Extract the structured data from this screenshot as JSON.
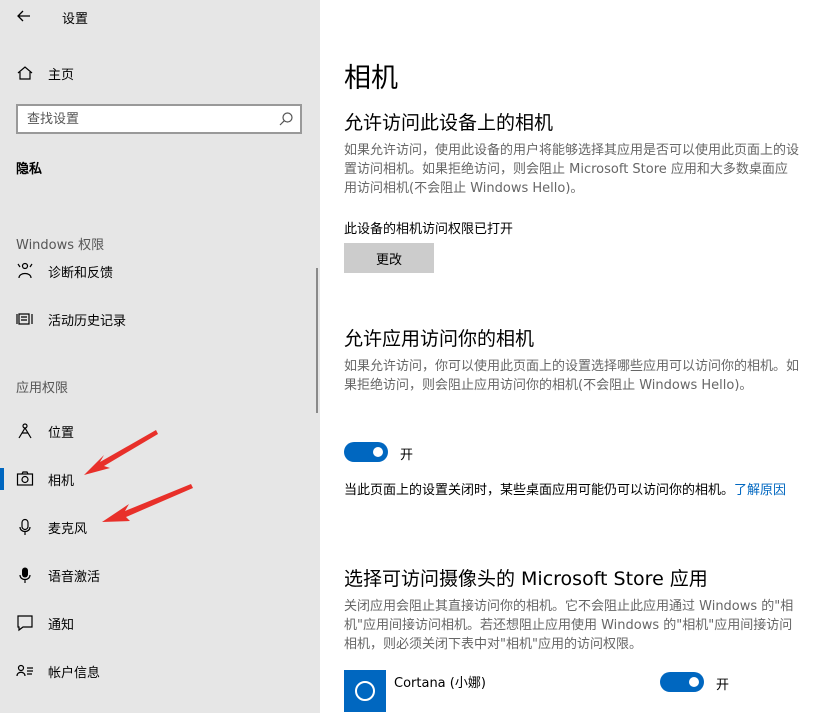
{
  "window": {
    "title": "设置"
  },
  "sidebar": {
    "home_label": "主页",
    "search_placeholder": "查找设置",
    "section_title": "隐私",
    "windows_group_label": "Windows 权限",
    "windows_items": [
      {
        "label": "诊断和反馈",
        "icon": "diagnostics-icon"
      },
      {
        "label": "活动历史记录",
        "icon": "activity-history-icon"
      }
    ],
    "app_group_label": "应用权限",
    "app_items": [
      {
        "label": "位置",
        "icon": "location-icon"
      },
      {
        "label": "相机",
        "icon": "camera-icon",
        "selected": true
      },
      {
        "label": "麦克风",
        "icon": "microphone-icon"
      },
      {
        "label": "语音激活",
        "icon": "voice-activation-icon"
      },
      {
        "label": "通知",
        "icon": "notification-icon"
      },
      {
        "label": "帐户信息",
        "icon": "account-info-icon"
      }
    ]
  },
  "main": {
    "page_title": "相机",
    "device_section": {
      "heading": "允许访问此设备上的相机",
      "description": "如果允许访问，使用此设备的用户将能够选择其应用是否可以使用此页面上的设置访问相机。如果拒绝访问，则会阻止 Microsoft Store 应用和大多数桌面应用访问相机(不会阻止 Windows Hello)。",
      "status": "此设备的相机访问权限已打开",
      "change_button": "更改"
    },
    "apps_section": {
      "heading": "允许应用访问你的相机",
      "description": "如果允许访问，你可以使用此页面上的设置选择哪些应用可以访问你的相机。如果拒绝访问，则会阻止应用访问你的相机(不会阻止 Windows Hello)。",
      "toggle_label": "开",
      "toggle_on": true,
      "note": "当此页面上的设置关闭时，某些桌面应用可能仍可以访问你的相机。",
      "note_link": "了解原因"
    },
    "store_section": {
      "heading": "选择可访问摄像头的 Microsoft Store 应用",
      "description": "关闭应用会阻止其直接访问你的相机。它不会阻止此应用通过 Windows 的\"相机\"应用间接访问相机。若还想阻止应用使用 Windows 的\"相机\"应用间接访问相机，则必须关闭下表中对\"相机\"应用的访问权限。",
      "apps": [
        {
          "name": "Cortana (小娜)",
          "toggle_label": "开",
          "on": true
        }
      ]
    }
  },
  "colors": {
    "accent": "#0067c0",
    "sidebar_bg": "#e6e6e6",
    "arrow": "#e8302a"
  }
}
